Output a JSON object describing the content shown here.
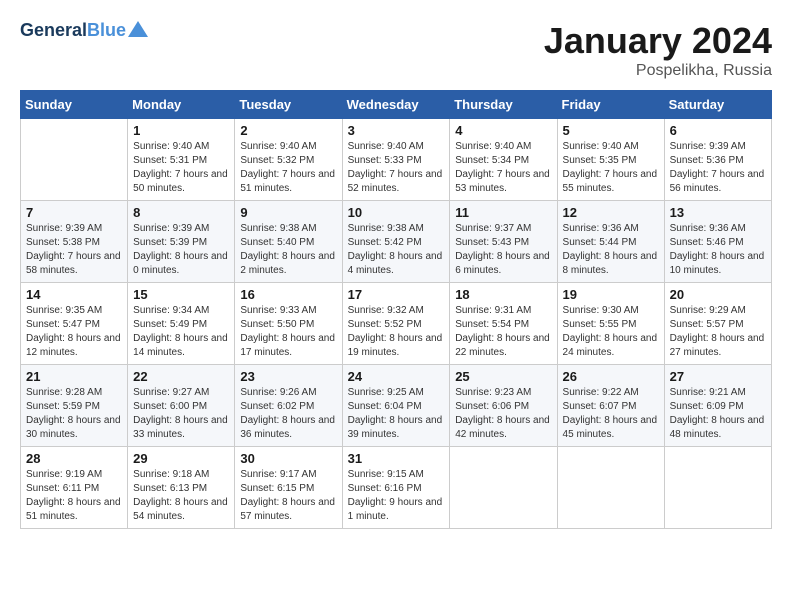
{
  "header": {
    "logo_line1": "General",
    "logo_line2": "Blue",
    "month": "January 2024",
    "location": "Pospelikha, Russia"
  },
  "weekdays": [
    "Sunday",
    "Monday",
    "Tuesday",
    "Wednesday",
    "Thursday",
    "Friday",
    "Saturday"
  ],
  "weeks": [
    [
      {
        "day": "",
        "sunrise": "",
        "sunset": "",
        "daylight": ""
      },
      {
        "day": "1",
        "sunrise": "Sunrise: 9:40 AM",
        "sunset": "Sunset: 5:31 PM",
        "daylight": "Daylight: 7 hours and 50 minutes."
      },
      {
        "day": "2",
        "sunrise": "Sunrise: 9:40 AM",
        "sunset": "Sunset: 5:32 PM",
        "daylight": "Daylight: 7 hours and 51 minutes."
      },
      {
        "day": "3",
        "sunrise": "Sunrise: 9:40 AM",
        "sunset": "Sunset: 5:33 PM",
        "daylight": "Daylight: 7 hours and 52 minutes."
      },
      {
        "day": "4",
        "sunrise": "Sunrise: 9:40 AM",
        "sunset": "Sunset: 5:34 PM",
        "daylight": "Daylight: 7 hours and 53 minutes."
      },
      {
        "day": "5",
        "sunrise": "Sunrise: 9:40 AM",
        "sunset": "Sunset: 5:35 PM",
        "daylight": "Daylight: 7 hours and 55 minutes."
      },
      {
        "day": "6",
        "sunrise": "Sunrise: 9:39 AM",
        "sunset": "Sunset: 5:36 PM",
        "daylight": "Daylight: 7 hours and 56 minutes."
      }
    ],
    [
      {
        "day": "7",
        "sunrise": "Sunrise: 9:39 AM",
        "sunset": "Sunset: 5:38 PM",
        "daylight": "Daylight: 7 hours and 58 minutes."
      },
      {
        "day": "8",
        "sunrise": "Sunrise: 9:39 AM",
        "sunset": "Sunset: 5:39 PM",
        "daylight": "Daylight: 8 hours and 0 minutes."
      },
      {
        "day": "9",
        "sunrise": "Sunrise: 9:38 AM",
        "sunset": "Sunset: 5:40 PM",
        "daylight": "Daylight: 8 hours and 2 minutes."
      },
      {
        "day": "10",
        "sunrise": "Sunrise: 9:38 AM",
        "sunset": "Sunset: 5:42 PM",
        "daylight": "Daylight: 8 hours and 4 minutes."
      },
      {
        "day": "11",
        "sunrise": "Sunrise: 9:37 AM",
        "sunset": "Sunset: 5:43 PM",
        "daylight": "Daylight: 8 hours and 6 minutes."
      },
      {
        "day": "12",
        "sunrise": "Sunrise: 9:36 AM",
        "sunset": "Sunset: 5:44 PM",
        "daylight": "Daylight: 8 hours and 8 minutes."
      },
      {
        "day": "13",
        "sunrise": "Sunrise: 9:36 AM",
        "sunset": "Sunset: 5:46 PM",
        "daylight": "Daylight: 8 hours and 10 minutes."
      }
    ],
    [
      {
        "day": "14",
        "sunrise": "Sunrise: 9:35 AM",
        "sunset": "Sunset: 5:47 PM",
        "daylight": "Daylight: 8 hours and 12 minutes."
      },
      {
        "day": "15",
        "sunrise": "Sunrise: 9:34 AM",
        "sunset": "Sunset: 5:49 PM",
        "daylight": "Daylight: 8 hours and 14 minutes."
      },
      {
        "day": "16",
        "sunrise": "Sunrise: 9:33 AM",
        "sunset": "Sunset: 5:50 PM",
        "daylight": "Daylight: 8 hours and 17 minutes."
      },
      {
        "day": "17",
        "sunrise": "Sunrise: 9:32 AM",
        "sunset": "Sunset: 5:52 PM",
        "daylight": "Daylight: 8 hours and 19 minutes."
      },
      {
        "day": "18",
        "sunrise": "Sunrise: 9:31 AM",
        "sunset": "Sunset: 5:54 PM",
        "daylight": "Daylight: 8 hours and 22 minutes."
      },
      {
        "day": "19",
        "sunrise": "Sunrise: 9:30 AM",
        "sunset": "Sunset: 5:55 PM",
        "daylight": "Daylight: 8 hours and 24 minutes."
      },
      {
        "day": "20",
        "sunrise": "Sunrise: 9:29 AM",
        "sunset": "Sunset: 5:57 PM",
        "daylight": "Daylight: 8 hours and 27 minutes."
      }
    ],
    [
      {
        "day": "21",
        "sunrise": "Sunrise: 9:28 AM",
        "sunset": "Sunset: 5:59 PM",
        "daylight": "Daylight: 8 hours and 30 minutes."
      },
      {
        "day": "22",
        "sunrise": "Sunrise: 9:27 AM",
        "sunset": "Sunset: 6:00 PM",
        "daylight": "Daylight: 8 hours and 33 minutes."
      },
      {
        "day": "23",
        "sunrise": "Sunrise: 9:26 AM",
        "sunset": "Sunset: 6:02 PM",
        "daylight": "Daylight: 8 hours and 36 minutes."
      },
      {
        "day": "24",
        "sunrise": "Sunrise: 9:25 AM",
        "sunset": "Sunset: 6:04 PM",
        "daylight": "Daylight: 8 hours and 39 minutes."
      },
      {
        "day": "25",
        "sunrise": "Sunrise: 9:23 AM",
        "sunset": "Sunset: 6:06 PM",
        "daylight": "Daylight: 8 hours and 42 minutes."
      },
      {
        "day": "26",
        "sunrise": "Sunrise: 9:22 AM",
        "sunset": "Sunset: 6:07 PM",
        "daylight": "Daylight: 8 hours and 45 minutes."
      },
      {
        "day": "27",
        "sunrise": "Sunrise: 9:21 AM",
        "sunset": "Sunset: 6:09 PM",
        "daylight": "Daylight: 8 hours and 48 minutes."
      }
    ],
    [
      {
        "day": "28",
        "sunrise": "Sunrise: 9:19 AM",
        "sunset": "Sunset: 6:11 PM",
        "daylight": "Daylight: 8 hours and 51 minutes."
      },
      {
        "day": "29",
        "sunrise": "Sunrise: 9:18 AM",
        "sunset": "Sunset: 6:13 PM",
        "daylight": "Daylight: 8 hours and 54 minutes."
      },
      {
        "day": "30",
        "sunrise": "Sunrise: 9:17 AM",
        "sunset": "Sunset: 6:15 PM",
        "daylight": "Daylight: 8 hours and 57 minutes."
      },
      {
        "day": "31",
        "sunrise": "Sunrise: 9:15 AM",
        "sunset": "Sunset: 6:16 PM",
        "daylight": "Daylight: 9 hours and 1 minute."
      },
      {
        "day": "",
        "sunrise": "",
        "sunset": "",
        "daylight": ""
      },
      {
        "day": "",
        "sunrise": "",
        "sunset": "",
        "daylight": ""
      },
      {
        "day": "",
        "sunrise": "",
        "sunset": "",
        "daylight": ""
      }
    ]
  ]
}
